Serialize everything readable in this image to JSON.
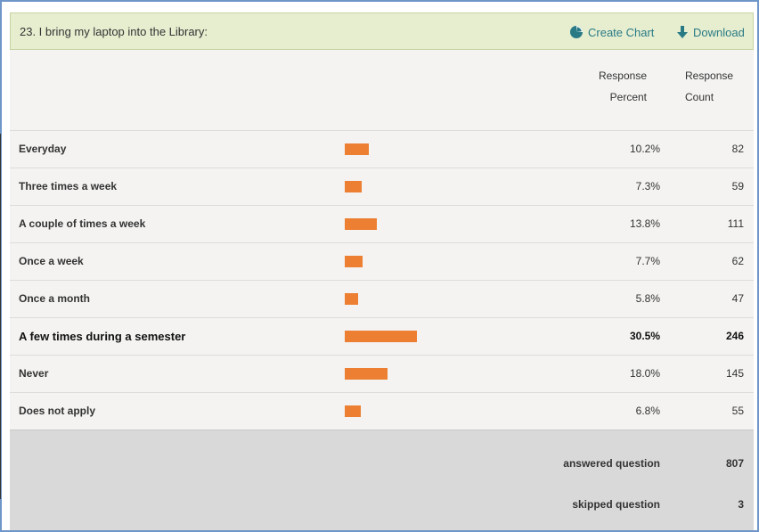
{
  "question": {
    "title": "23. I bring my laptop into the Library:",
    "create_chart_label": "Create Chart",
    "download_label": "Download",
    "header_bg": "#e6eecf",
    "link_color": "#2a7a86",
    "bar_color": "#ec7f32"
  },
  "columns": {
    "percent_line1": "Response",
    "percent_line2": "Percent",
    "count_line1": "Response",
    "count_line2": "Count"
  },
  "rows": [
    {
      "label": "Everyday",
      "percent": "10.2%",
      "count": "82",
      "fraction": 0.102
    },
    {
      "label": "Three times a week",
      "percent": "7.3%",
      "count": "59",
      "fraction": 0.073
    },
    {
      "label": "A couple of times a week",
      "percent": "13.8%",
      "count": "111",
      "fraction": 0.138
    },
    {
      "label": "Once a week",
      "percent": "7.7%",
      "count": "62",
      "fraction": 0.077
    },
    {
      "label": "Once a month",
      "percent": "5.8%",
      "count": "47",
      "fraction": 0.058
    },
    {
      "label": "A few times during a semester",
      "percent": "30.5%",
      "count": "246",
      "fraction": 0.305,
      "emphasis": true
    },
    {
      "label": "Never",
      "percent": "18.0%",
      "count": "145",
      "fraction": 0.18
    },
    {
      "label": "Does not apply",
      "percent": "6.8%",
      "count": "55",
      "fraction": 0.068
    }
  ],
  "summary": {
    "answered_label": "answered question",
    "answered_value": "807",
    "skipped_label": "skipped question",
    "skipped_value": "3"
  }
}
